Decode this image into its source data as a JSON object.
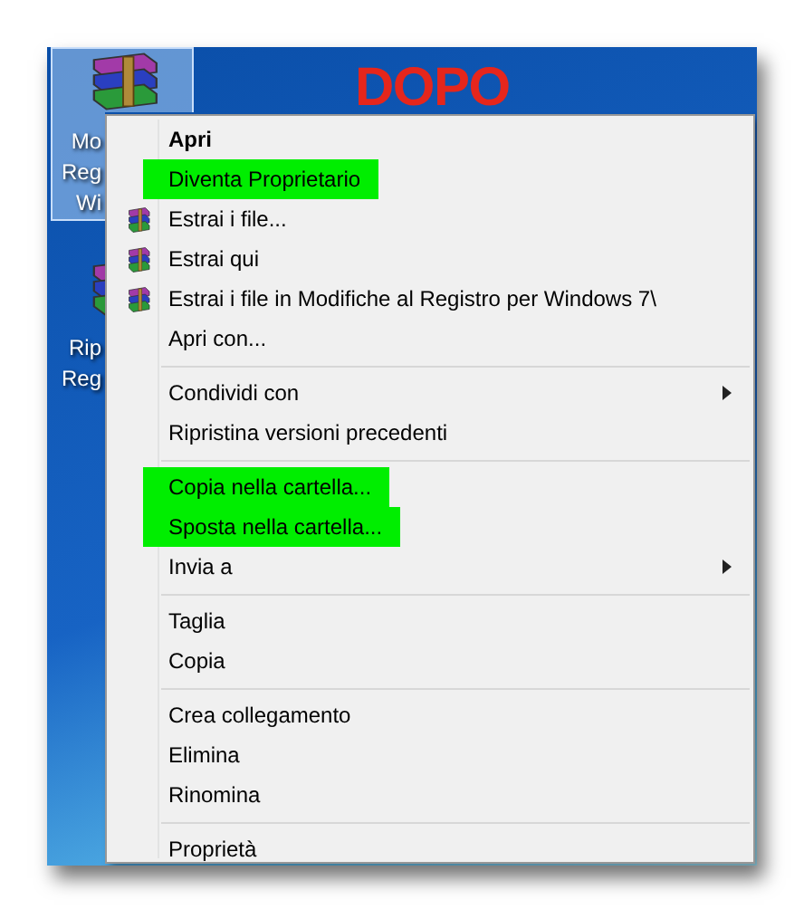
{
  "desktop": {
    "heading": "DOPO",
    "icons": [
      {
        "label_lines": [
          "Mo",
          "Reg",
          "Wi"
        ],
        "selected": true
      },
      {
        "label_lines": [
          "Rip",
          "Reg"
        ],
        "selected": false
      }
    ]
  },
  "context_menu": {
    "groups": [
      [
        {
          "label": "Apri",
          "default": true,
          "highlighted": false,
          "icon": false,
          "submenu": false
        },
        {
          "label": "Diventa Proprietario",
          "default": false,
          "highlighted": true,
          "icon": false,
          "submenu": false
        },
        {
          "label": "Estrai i file...",
          "default": false,
          "highlighted": false,
          "icon": true,
          "submenu": false
        },
        {
          "label": "Estrai qui",
          "default": false,
          "highlighted": false,
          "icon": true,
          "submenu": false
        },
        {
          "label": "Estrai i file in Modifiche al  Registro per Windows 7\\",
          "default": false,
          "highlighted": false,
          "icon": true,
          "submenu": false
        },
        {
          "label": "Apri con...",
          "default": false,
          "highlighted": false,
          "icon": false,
          "submenu": false
        }
      ],
      [
        {
          "label": "Condividi con",
          "default": false,
          "highlighted": false,
          "icon": false,
          "submenu": true
        },
        {
          "label": "Ripristina versioni precedenti",
          "default": false,
          "highlighted": false,
          "icon": false,
          "submenu": false
        }
      ],
      [
        {
          "label": "Copia nella cartella...",
          "default": false,
          "highlighted": true,
          "icon": false,
          "submenu": false
        },
        {
          "label": "Sposta nella cartella...",
          "default": false,
          "highlighted": true,
          "icon": false,
          "submenu": false
        },
        {
          "label": "Invia a",
          "default": false,
          "highlighted": false,
          "icon": false,
          "submenu": true
        }
      ],
      [
        {
          "label": "Taglia",
          "default": false,
          "highlighted": false,
          "icon": false,
          "submenu": false
        },
        {
          "label": "Copia",
          "default": false,
          "highlighted": false,
          "icon": false,
          "submenu": false
        }
      ],
      [
        {
          "label": "Crea collegamento",
          "default": false,
          "highlighted": false,
          "icon": false,
          "submenu": false
        },
        {
          "label": "Elimina",
          "default": false,
          "highlighted": false,
          "icon": false,
          "submenu": false
        },
        {
          "label": "Rinomina",
          "default": false,
          "highlighted": false,
          "icon": false,
          "submenu": false
        }
      ],
      [
        {
          "label": "Proprietà",
          "default": false,
          "highlighted": false,
          "icon": false,
          "submenu": false
        }
      ]
    ]
  }
}
